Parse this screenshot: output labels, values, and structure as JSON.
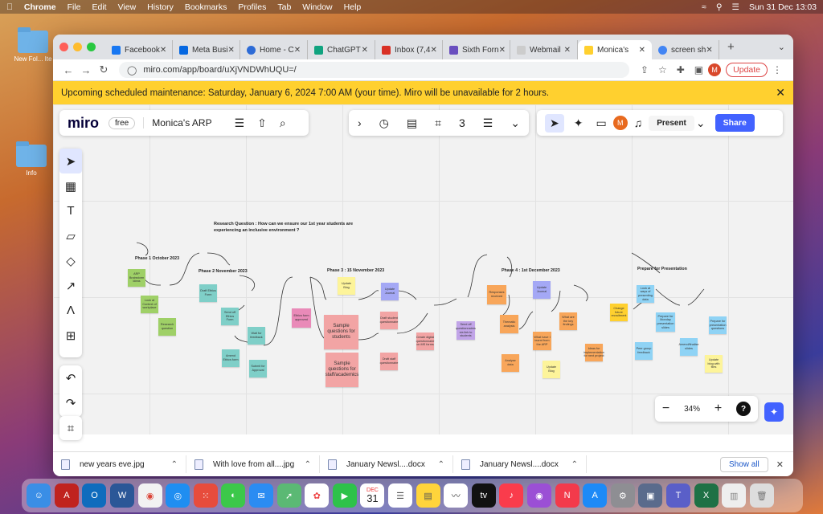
{
  "menubar": {
    "app": "Chrome",
    "items": [
      "File",
      "Edit",
      "View",
      "History",
      "Bookmarks",
      "Profiles",
      "Tab",
      "Window",
      "Help"
    ],
    "clock": "Sun 31 Dec  13:03"
  },
  "desktop": {
    "icons": [
      {
        "label": "New Fol... Ite"
      },
      {
        "label": "Info"
      }
    ]
  },
  "browser": {
    "tabs": [
      {
        "label": "Facebook",
        "color": "#1877f2"
      },
      {
        "label": "Meta Busi",
        "color": "#0668e1"
      },
      {
        "label": "Home - C",
        "color": "#2d6bd6"
      },
      {
        "label": "ChatGPT",
        "color": "#10a37f"
      },
      {
        "label": "Inbox (7,4",
        "color": "#d93025"
      },
      {
        "label": "Sixth Forn",
        "color": "#6a4fbf"
      },
      {
        "label": "Webmail",
        "color": "#888888"
      },
      {
        "label": "Monica's",
        "color": "#ffd02f"
      },
      {
        "label": "screen sh",
        "color": "#4285f4"
      }
    ],
    "url": "miro.com/app/board/uXjVNDWhUQU=/",
    "profile_initial": "M",
    "update_label": "Update"
  },
  "banner": {
    "text": "Upcoming scheduled maintenance: Saturday, January 6, 2024 7:00 AM (your time). Miro will be unavailable for 2 hours."
  },
  "miro": {
    "logo": "miro",
    "plan": "free",
    "board_name": "Monica's ARP",
    "present_label": "Present",
    "share_label": "Share",
    "avatar_initial": "M",
    "zoom": "34%",
    "timer_count": "3"
  },
  "board": {
    "research_question": "Research Question : How can we ensure our 1st year students are experiencing an inclusive environment ?",
    "phases": [
      "Phase 1 October 2023",
      "Phase 2 November 2023",
      "Phase 3 : 15 November 2023",
      "Phase 4 : 1st December 2023",
      "Prepare for Presentation"
    ],
    "notes": {
      "n1": "ARP Brainstorm ideas",
      "n2": "Look at Context of workplace",
      "n3": "Research question",
      "n4": "Draft Ethics Form",
      "n5": "Send off Ethics Form",
      "n6": "Wait for feedback",
      "n7": "Amend Ethics form",
      "n8": "Submit for Approval",
      "n9": "Ethics form approved",
      "n10": "Update Blog",
      "n11": "Sample questions for students",
      "n12": "Sample questions for staff/academics",
      "n13": "Update Journal",
      "n14": "Draft student questionnaire",
      "n15": "Draft staff questionnaire",
      "n16": "Create digital questionnaire on MS forms",
      "n17": "Send off questionnaires via link to students",
      "n18": "Responses received",
      "n19": "Thematic analysis",
      "n20": "Analyse data",
      "n21": "Update Journal",
      "n22": "What are the key findings",
      "n23": "What have I learnt from the ARP",
      "n24": "Update Blog",
      "n25": "Ideas for implementation for next project",
      "n26": "Change future recruitment",
      "n27": "Look at ways of presenting data",
      "n28": "Prepare for Monday presentation slides",
      "n29": "Peer group feedback",
      "n30": "Amend/finalise slides",
      "n31": "Prepare for presentation questions",
      "n32": "Update blog with files"
    }
  },
  "downloads": {
    "items": [
      "new years eve.jpg",
      "With love from all....jpg",
      "January Newsl....docx",
      "January Newsl....docx"
    ],
    "show_all": "Show all"
  },
  "dock": {
    "calendar_day": "31",
    "calendar_month": "DEC"
  }
}
